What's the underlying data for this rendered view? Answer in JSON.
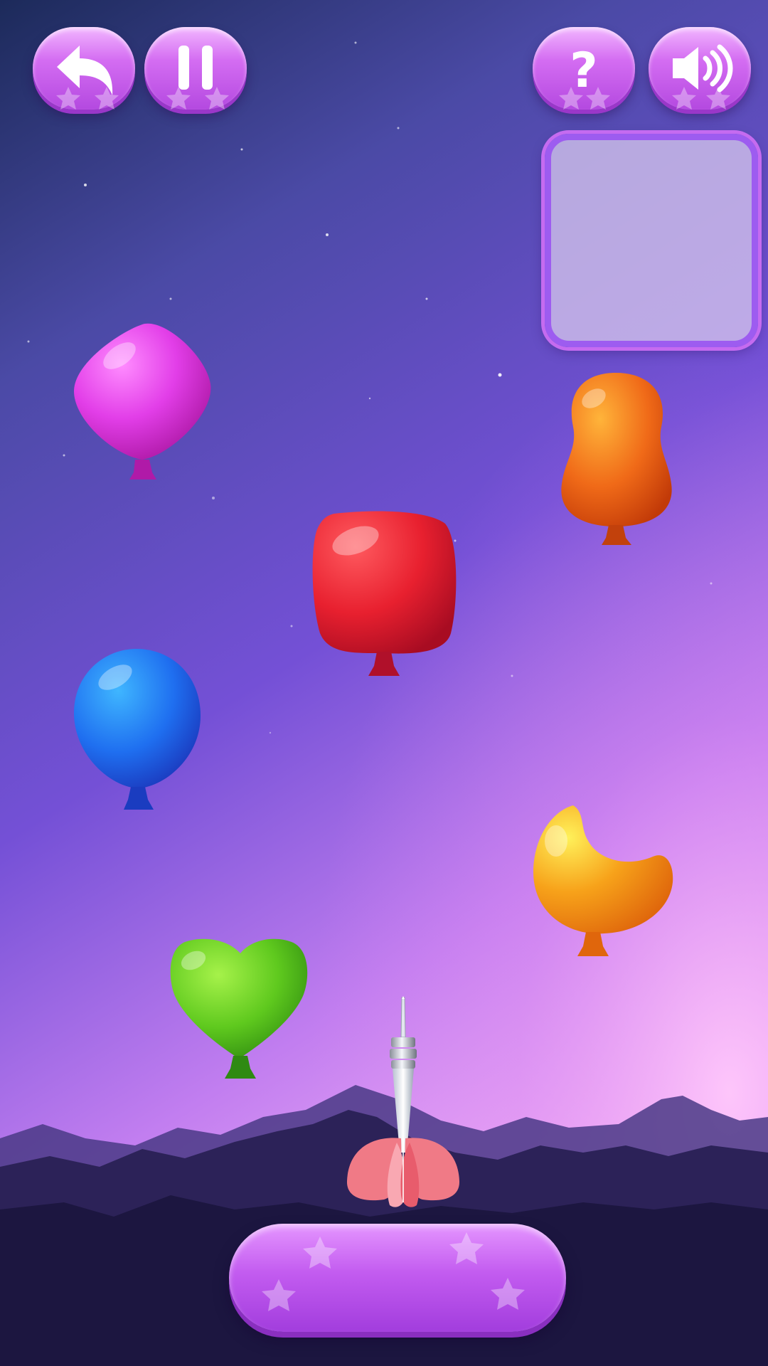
{
  "game": {
    "type": "balloon-dart-shooter",
    "target_preview": {
      "contents": "empty"
    }
  },
  "buttons": {
    "back": {
      "icon": "back-arrow-icon"
    },
    "pause": {
      "icon": "pause-icon"
    },
    "help": {
      "icon": "question-icon",
      "glyph": "?"
    },
    "sound": {
      "icon": "speaker-icon"
    },
    "action": {
      "icon": "stars-decoration"
    }
  },
  "balloons": [
    {
      "id": "pink-diamond",
      "shape": "diamond",
      "color": "#e23ee8"
    },
    {
      "id": "orange-peanut",
      "shape": "peanut",
      "color": "#f06a18"
    },
    {
      "id": "red-square",
      "shape": "rounded-square",
      "color": "#e8202f"
    },
    {
      "id": "blue-round",
      "shape": "round",
      "color": "#1f6ff0"
    },
    {
      "id": "yellow-moon",
      "shape": "crescent",
      "color": "#f7a21a"
    },
    {
      "id": "green-heart",
      "shape": "heart",
      "color": "#5fc91e"
    }
  ],
  "dart": {
    "tip_color": "#d9dde6",
    "flight_color": "#f07a86"
  },
  "colors": {
    "sky_top": "#232a5e",
    "sky_mid": "#6a4ccc",
    "sky_glow": "#f2a6f6",
    "mountains": "#241a46",
    "button_purple": "#c65cf0"
  }
}
